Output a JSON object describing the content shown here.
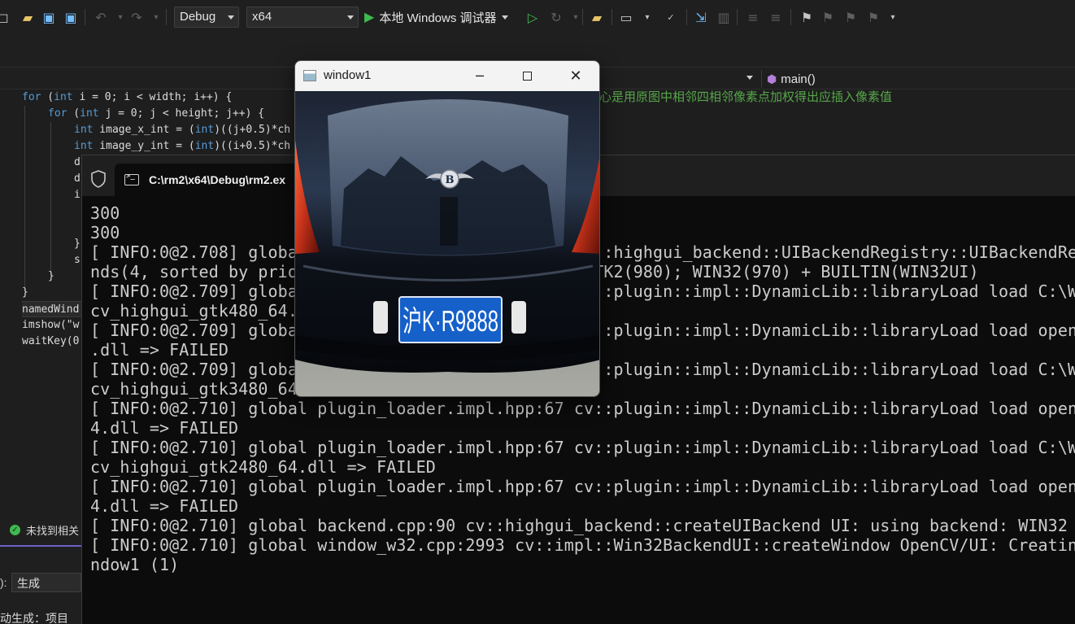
{
  "toolbar": {
    "config": "Debug",
    "platform": "x64",
    "run_label": "本地 Windows 调试器"
  },
  "editor": {
    "navbar_member": "main()",
    "comment": "心是用原图中相邻四相邻像素点加权得出应插入像素值",
    "lines": [
      "for (int i = 0; i < width; i++) {",
      "for (int j = 0; j < height; j++) {",
      "int image_x_int = (int)((j+0.5)*ch",
      "int image_y_int = (int)((i+0.5)*ch",
      "d",
      "d",
      "i",
      "",
      "",
      "}",
      "s",
      "}",
      "}",
      "namedWind",
      "imshow(\"w",
      "waitKey(0"
    ]
  },
  "status": {
    "message": "未找到相关"
  },
  "output": {
    "from_label": "):",
    "source": "生成",
    "text": "动生成：项目"
  },
  "console": {
    "tab_title": "C:\\rm2\\x64\\Debug\\rm2.ex",
    "lines": [
      "300",
      "300",
      "[ INFO:0@2.708] global plugin_loader.impl.hpp:67 cv::highgui_backend::UIBackendRegistry::UIBackendRegistr",
      "nds(4, sorted by priority): GTK(1000); GTK3(990); GTK2(980); WIN32(970) + BUILTIN(WIN32UI)",
      "[ INFO:0@2.709] global plugin_loader.impl.hpp:67 cv::plugin::impl::DynamicLib::libraryLoad load C:\\Wi",
      "cv_highgui_gtk480_64.dll => FAILED",
      "[ INFO:0@2.709] global plugin_loader.impl.hpp:67 cv::plugin::impl::DynamicLib::libraryLoad load openc",
      ".dll => FAILED",
      "[ INFO:0@2.709] global plugin_loader.impl.hpp:67 cv::plugin::impl::DynamicLib::libraryLoad load C:\\Wi",
      "cv_highgui_gtk3480_64.dll => FAILED",
      "[ INFO:0@2.710] global plugin_loader.impl.hpp:67 cv::plugin::impl::DynamicLib::libraryLoad load openc",
      "4.dll => FAILED",
      "[ INFO:0@2.710] global plugin_loader.impl.hpp:67 cv::plugin::impl::DynamicLib::libraryLoad load C:\\Wi",
      "cv_highgui_gtk2480_64.dll => FAILED",
      "[ INFO:0@2.710] global plugin_loader.impl.hpp:67 cv::plugin::impl::DynamicLib::libraryLoad load openc",
      "4.dll => FAILED",
      "[ INFO:0@2.710] global backend.cpp:90 cv::highgui_backend::createUIBackend UI: using backend: WIN32 (",
      "[ INFO:0@2.710] global window_w32.cpp:2993 cv::impl::Win32BackendUI::createWindow OpenCV/UI: Creating",
      "ndow1 (1)"
    ]
  },
  "cv_window": {
    "title": "window1",
    "plate_text": "沪K·R9888",
    "emblem_letter": "B"
  },
  "colors": {
    "keyword": "#569cd6",
    "comment": "#57a64a",
    "accent": "#6c5fc7",
    "plate_blue": "#1560c9"
  }
}
